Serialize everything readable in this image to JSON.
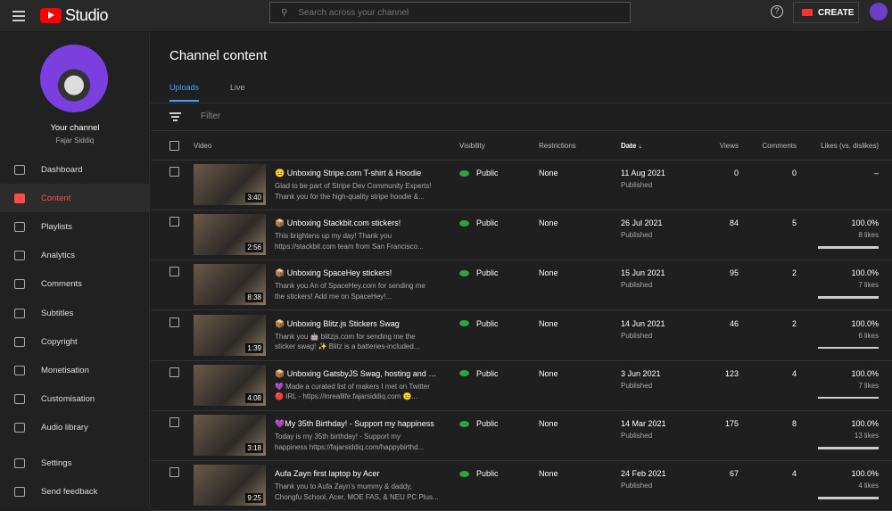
{
  "app": {
    "title": "Studio",
    "search_placeholder": "Search across your channel",
    "create_label": "CREATE",
    "help": "?"
  },
  "sidebar": {
    "your_channel": "Your channel",
    "channel_name": "Fajar Siddiq",
    "items": [
      {
        "label": "Dashboard",
        "icon": "dashboard-icon"
      },
      {
        "label": "Content",
        "icon": "content-icon",
        "active": true
      },
      {
        "label": "Playlists",
        "icon": "playlists-icon"
      },
      {
        "label": "Analytics",
        "icon": "analytics-icon"
      },
      {
        "label": "Comments",
        "icon": "comments-icon"
      },
      {
        "label": "Subtitles",
        "icon": "subtitles-icon"
      },
      {
        "label": "Copyright",
        "icon": "copyright-icon"
      },
      {
        "label": "Monetisation",
        "icon": "monetisation-icon"
      },
      {
        "label": "Customisation",
        "icon": "customisation-icon"
      },
      {
        "label": "Audio library",
        "icon": "audio-library-icon"
      }
    ],
    "footer": [
      {
        "label": "Settings",
        "icon": "gear-icon"
      },
      {
        "label": "Send feedback",
        "icon": "feedback-icon"
      }
    ]
  },
  "main": {
    "title": "Channel content",
    "tabs": [
      "Uploads",
      "Live"
    ],
    "filter_placeholder": "Filter",
    "columns": {
      "video": "Video",
      "visibility": "Visibility",
      "restrictions": "Restrictions",
      "date": "Date",
      "date_sort": "↓",
      "views": "Views",
      "comments": "Comments",
      "likes": "Likes (vs. dislikes)"
    },
    "rows": [
      {
        "title": "😐 Unboxing Stripe.com T-shirt & Hoodie",
        "desc1": "Glad to be part of Stripe Dev Community Experts!",
        "desc2": "Thank you for the high-quality stripe hoodie &...",
        "duration": "3:40",
        "visibility": "Public",
        "restrictions": "None",
        "date": "11 Aug 2021",
        "status": "Published",
        "views": "0",
        "comments": "0",
        "likes": "–",
        "likes_count": "",
        "like_ratio": null
      },
      {
        "title": "📦 Unboxing Stackbit.com stickers!",
        "desc1": "This brightens up my day! Thank you",
        "desc2": "https://stackbit.com team from San Francisco...",
        "duration": "2:56",
        "visibility": "Public",
        "restrictions": "None",
        "date": "26 Jul 2021",
        "status": "Published",
        "views": "84",
        "comments": "5",
        "likes": "100.0%",
        "likes_count": "8 likes",
        "like_ratio": 1
      },
      {
        "title": "📦 Unboxing SpaceHey stickers!",
        "desc1": "Thank you An of SpaceHey.com for sending me",
        "desc2": "the stickers! Add me on SpaceHey!...",
        "duration": "8:38",
        "visibility": "Public",
        "restrictions": "None",
        "date": "15 Jun 2021",
        "status": "Published",
        "views": "95",
        "comments": "2",
        "likes": "100.0%",
        "likes_count": "7 likes",
        "like_ratio": 1
      },
      {
        "title": "📦 Unboxing Blitz.js Stickers Swag",
        "desc1": "Thank you 🤖 blitzjs.com for sending me the",
        "desc2": "sticker swag! ✨ Blitz is a batteries-included...",
        "duration": "1:39",
        "visibility": "Public",
        "restrictions": "None",
        "date": "14 Jun 2021",
        "status": "Published",
        "views": "46",
        "comments": "2",
        "likes": "100.0%",
        "likes_count": "6 likes",
        "like_ratio": 1
      },
      {
        "title": "📦 Unboxing GatsbyJS Swag, hosting and ma...",
        "desc1": "💜 Made a curated list of makers I met on Twitter",
        "desc2": "🔴 IRL - https://inreallife.fajarsiddiq.com 😐...",
        "duration": "4:08",
        "visibility": "Public",
        "restrictions": "None",
        "date": "3 Jun 2021",
        "status": "Published",
        "views": "123",
        "comments": "4",
        "likes": "100.0%",
        "likes_count": "7 likes",
        "like_ratio": 1
      },
      {
        "title": "💜My 35th Birthday! - Support my happiness",
        "desc1": "Today is my 35th birthday! - Support my",
        "desc2": "happiness https://fajarsiddiq.com/happybirthd...",
        "duration": "3:18",
        "visibility": "Public",
        "restrictions": "None",
        "date": "14 Mar 2021",
        "status": "Published",
        "views": "175",
        "comments": "8",
        "likes": "100.0%",
        "likes_count": "13 likes",
        "like_ratio": 1
      },
      {
        "title": "Aufa Zayn first laptop by Acer",
        "desc1": "Thank you to Aufa Zayn's mummy & daddy,",
        "desc2": "Chongfu School, Acer, MOE FAS, & NEU PC Plus...",
        "duration": "9:25",
        "visibility": "Public",
        "restrictions": "None",
        "date": "24 Feb 2021",
        "status": "Published",
        "views": "67",
        "comments": "4",
        "likes": "100.0%",
        "likes_count": "4 likes",
        "like_ratio": 1
      }
    ]
  }
}
